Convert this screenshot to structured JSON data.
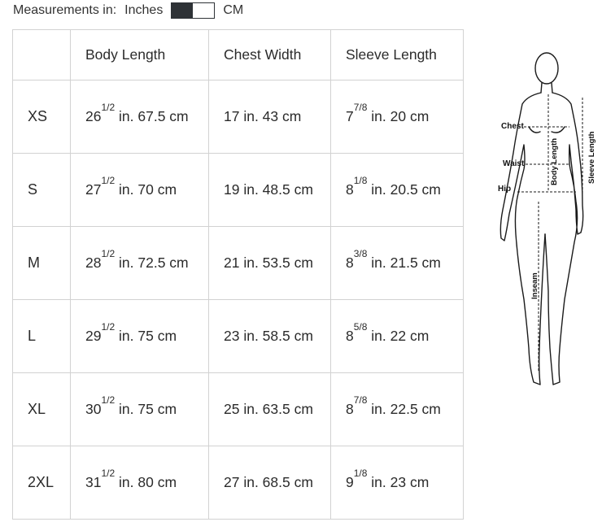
{
  "units": {
    "label": "Measurements in:",
    "inches": "Inches",
    "cm": "CM",
    "selected": "Inches"
  },
  "table": {
    "headers": [
      "",
      "Body Length",
      "Chest Width",
      "Sleeve Length"
    ],
    "rows": [
      {
        "size": "XS",
        "body": {
          "whole": "26",
          "frac": "1/2",
          "rest": " in. 67.5 cm"
        },
        "chest": {
          "whole": "17 in. 43 cm",
          "frac": "",
          "rest": ""
        },
        "sleeve": {
          "whole": "7",
          "frac": "7/8",
          "rest": " in. 20 cm"
        }
      },
      {
        "size": "S",
        "body": {
          "whole": "27",
          "frac": "1/2",
          "rest": " in. 70 cm"
        },
        "chest": {
          "whole": "19 in. 48.5 cm",
          "frac": "",
          "rest": ""
        },
        "sleeve": {
          "whole": "8",
          "frac": "1/8",
          "rest": " in. 20.5 cm"
        }
      },
      {
        "size": "M",
        "body": {
          "whole": "28",
          "frac": "1/2",
          "rest": " in. 72.5 cm"
        },
        "chest": {
          "whole": "21 in. 53.5 cm",
          "frac": "",
          "rest": ""
        },
        "sleeve": {
          "whole": "8",
          "frac": "3/8",
          "rest": " in. 21.5 cm"
        }
      },
      {
        "size": "L",
        "body": {
          "whole": "29",
          "frac": "1/2",
          "rest": " in. 75 cm"
        },
        "chest": {
          "whole": "23 in. 58.5 cm",
          "frac": "",
          "rest": ""
        },
        "sleeve": {
          "whole": "8",
          "frac": "5/8",
          "rest": " in. 22 cm"
        }
      },
      {
        "size": "XL",
        "body": {
          "whole": "30",
          "frac": "1/2",
          "rest": " in. 75 cm"
        },
        "chest": {
          "whole": "25 in. 63.5 cm",
          "frac": "",
          "rest": ""
        },
        "sleeve": {
          "whole": "8",
          "frac": "7/8",
          "rest": " in. 22.5 cm"
        }
      },
      {
        "size": "2XL",
        "body": {
          "whole": "31",
          "frac": "1/2",
          "rest": " in. 80 cm"
        },
        "chest": {
          "whole": "27 in. 68.5 cm",
          "frac": "",
          "rest": ""
        },
        "sleeve": {
          "whole": "9",
          "frac": "1/8",
          "rest": " in. 23 cm"
        }
      }
    ]
  },
  "figure": {
    "labels": {
      "chest": "Chest",
      "waist": "Waist",
      "hip": "Hip",
      "body_length": "Body Length",
      "inseam": "Inseam",
      "sleeve_length": "Sleeve Length"
    }
  },
  "colors": {
    "toggle": "#2e3236",
    "border": "#d2d2d2",
    "text": "#2b2b2b"
  }
}
